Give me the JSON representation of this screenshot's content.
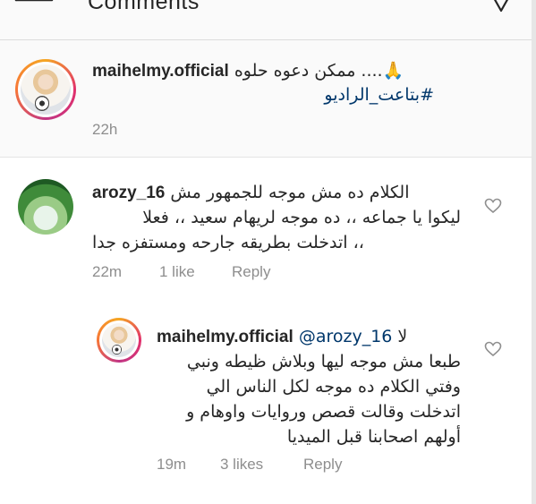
{
  "header": {
    "title": "Comments"
  },
  "caption": {
    "username": "maihelmy.official",
    "text_line1": "🙏.... ممكن دعوه حلوه",
    "hashtag": "#بتاعت_الراديو",
    "time": "22h"
  },
  "comments": [
    {
      "username": "arozy_16",
      "line1": "الكلام ده مش موجه للجمهور مش",
      "line2": "ليكوا يا جماعه ،، ده موجه لريهام سعيد ،، فعلا",
      "line3": "،، اتدخلت بطريقه جارحه ومستفزه جدا",
      "time": "22m",
      "likes": "1 like",
      "reply": "Reply"
    },
    {
      "username": "maihelmy.official",
      "mention": "@arozy_16",
      "line1_suffix": "لا",
      "line2": "طبعا مش موجه ليها وبلاش ظيطه ونبي",
      "line3": "وفتي الكلام ده موجه لكل الناس الي",
      "line4": "اتدخلت وقالت قصص وروايات واوهام و",
      "line5": "أولهم اصحابنا قبل الميديا",
      "time": "19m",
      "likes": "3 likes",
      "reply": "Reply"
    }
  ],
  "colors": {
    "link": "#00376b",
    "meta": "#8e8e8e",
    "text": "#262626"
  },
  "icons": [
    "back-arrow-icon",
    "chevron-down-icon",
    "heart-icon"
  ]
}
